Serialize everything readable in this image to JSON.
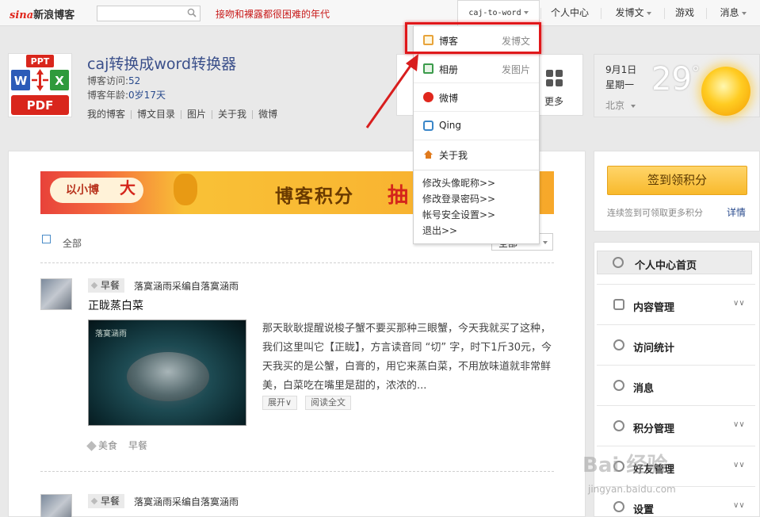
{
  "topbar": {
    "logo_brand": "sina",
    "logo_text": "新浪博客",
    "search_placeholder": "",
    "slogan": "接吻和裸露都很困难的年代",
    "user_name": "caj-to-word",
    "nav": [
      "个人中心",
      "发博文",
      "游戏",
      "消息"
    ]
  },
  "header": {
    "blog_title": "caj转换成word转换器",
    "visits_label": "博客访问:",
    "visits_value": "52",
    "age_label": "博客年龄:",
    "age_value": "0岁17天",
    "links": [
      "我的博客",
      "博文目录",
      "图片",
      "关于我",
      "微博"
    ],
    "avatar_texts": [
      "PPT",
      "W",
      "X",
      "PDF"
    ],
    "more_label": "更多"
  },
  "weather": {
    "date": "9月1日",
    "weekday": "星期一",
    "temp": "29",
    "deg": "°",
    "city": "北京"
  },
  "dropdown": {
    "items": [
      {
        "label": "博客",
        "action": "发博文",
        "icon": "blog-icon",
        "color": "#e8a33a"
      },
      {
        "label": "相册",
        "action": "发图片",
        "icon": "photo-icon",
        "color": "#3b9b4b"
      },
      {
        "label": "微博",
        "action": "",
        "icon": "weibo-icon",
        "color": "#e0271d"
      },
      {
        "label": "Qing",
        "action": "",
        "icon": "qing-icon",
        "color": "#3a86c8"
      },
      {
        "label": "关于我",
        "action": "",
        "icon": "home-icon",
        "color": "#e07a1d"
      }
    ],
    "links": [
      "修改头像昵称>>",
      "修改登录密码>>",
      "帐号安全设置>>",
      "退出>>"
    ]
  },
  "main": {
    "banner": {
      "small": "以小博",
      "big": "大",
      "center": "博客积分",
      "right": "抽"
    },
    "filter_label": "全部",
    "filter_select": "全部",
    "posts": [
      {
        "tag": "早餐",
        "source": "落寞涵雨采编自落寞涵雨",
        "title": "正眬蒸白菜",
        "image_caption": "落寞涵雨",
        "body": "那天耿耿提醒说梭子蟹不要买那种三眼蟹，今天我就买了这种，我们这里叫它【正眬】，方言读音同 “切” 字，时下1斤30元，今天我买的是公蟹，白膏的，用它来蒸白菜，不用放味道就非常鲜美，白菜吃在嘴里是甜的，浓浓的...",
        "expand": "展开",
        "read_more": "阅读全文",
        "tags": [
          "美食",
          "早餐"
        ]
      },
      {
        "tag": "早餐",
        "source": "落寞涵雨采编自落寞涵雨"
      }
    ]
  },
  "sidebar": {
    "checkin": "签到领积分",
    "hint": "连续签到可领取更多积分",
    "detail": "详情",
    "home": "个人中心首页",
    "items": [
      "内容管理",
      "访问统计",
      "消息",
      "积分管理",
      "好友管理",
      "设置"
    ]
  },
  "watermark": {
    "main": "Bai 经验",
    "sub": "jingyan.baidu.com"
  },
  "colors": {
    "accent_red": "#e0171a",
    "link_blue": "#2a4b8d",
    "checkin_yellow": "#f8b92c"
  }
}
